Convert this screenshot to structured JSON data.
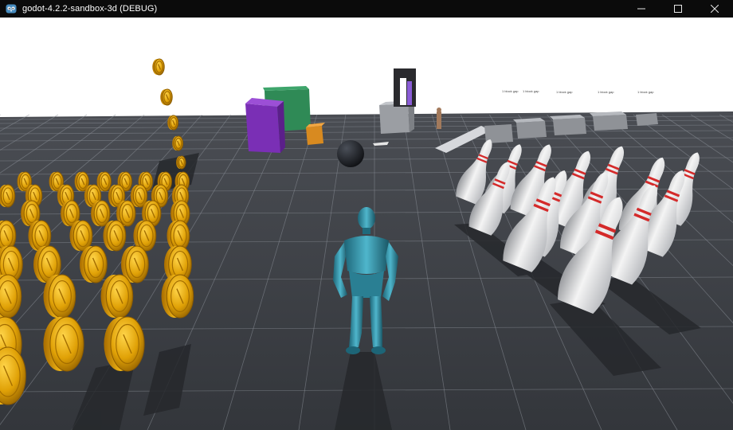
{
  "window": {
    "title": "godot-4.2.2-sandbox-3d (DEBUG)",
    "controls": {
      "minimize_icon": "minimize-icon",
      "maximize_icon": "maximize-icon",
      "close_icon": "close-icon"
    }
  },
  "scene": {
    "sky_color": "#ffffff",
    "floor_color": "#3a3d43",
    "grid_color": "#9ea3ab",
    "coin_color": "#e0a106",
    "character_color": "#2f8fa6",
    "pin_color": "#e8e8e8",
    "pin_stripe_color": "#d42a2a",
    "purple_box_color": "#7a2fb5",
    "green_box_color": "#2f8a56",
    "orange_box_color": "#d88a20",
    "ball_color": "#17191e",
    "sign_labels": [
      "1 block gap",
      "1 block gap",
      "1 block gap",
      "1 block gap",
      "1 block gap"
    ]
  }
}
